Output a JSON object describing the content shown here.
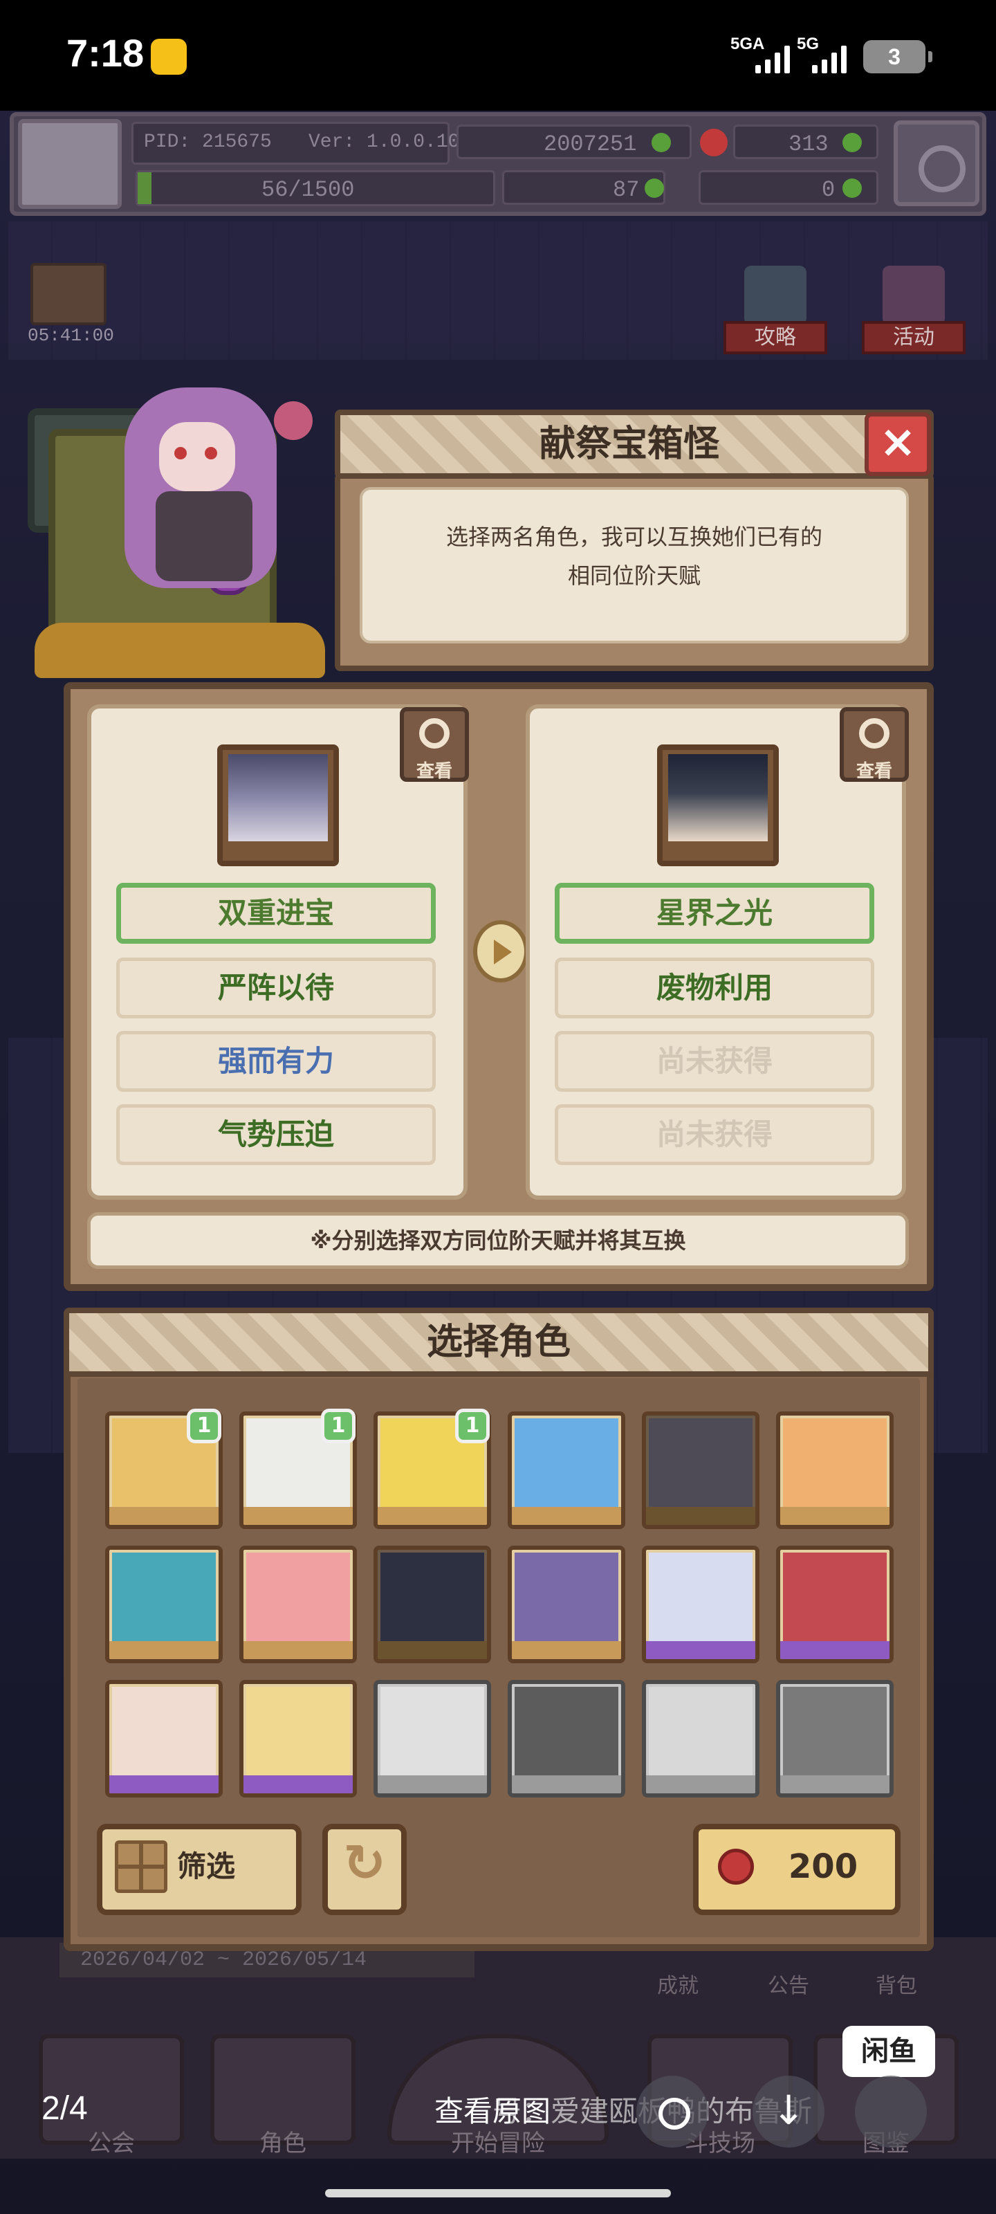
{
  "status_bar": {
    "time": "7:18",
    "signal1": "5GA",
    "signal2": "5G",
    "battery": "3"
  },
  "hud": {
    "pid": "PID: 215675",
    "version": "Ver: 1.0.0.10",
    "gold": "2007251",
    "red_gems": "313",
    "exp": "56/1500",
    "clover": "87",
    "key": "0",
    "colors": {
      "green_gem": "#5aa03a",
      "red_gem": "#c23a3a"
    }
  },
  "side": {
    "chest_timer": "05:41:00",
    "guide_label": "攻略",
    "event_label": "活动"
  },
  "modal": {
    "title": "献祭宝箱怪",
    "close_icon": "×",
    "description_line1": "选择两名角色，我可以互换她们已有的",
    "description_line2": "相同位阶天赋"
  },
  "swap": {
    "left": {
      "view_label": "查看",
      "talents": [
        {
          "label": "双重进宝",
          "state": "selected"
        },
        {
          "label": "严阵以待",
          "state": "owned"
        },
        {
          "label": "强而有力",
          "state": "owned"
        },
        {
          "label": "气势压迫",
          "state": "owned"
        }
      ]
    },
    "right": {
      "view_label": "查看",
      "talents": [
        {
          "label": "星界之光",
          "state": "selected"
        },
        {
          "label": "废物利用",
          "state": "owned"
        },
        {
          "label": "尚未获得",
          "state": "locked"
        },
        {
          "label": "尚未获得",
          "state": "locked"
        }
      ]
    },
    "hint": "※分别选择双方同位阶天赋并将其互换"
  },
  "select": {
    "title": "选择角色",
    "badge": "1",
    "filter_label": "筛选",
    "cost": "200"
  },
  "background": {
    "date_range": "2026/04/02 ~ 2026/05/14",
    "mini_labels": [
      "成就",
      "公告",
      "背包"
    ],
    "nav_labels": [
      "公会",
      "角色",
      "开始冒险",
      "斗技场",
      "图鉴"
    ]
  },
  "viewer": {
    "counter": "2/4",
    "view_original": "查看原图",
    "watermark": "号：爱建瓯板鸭的布鲁斯",
    "logo": "闲鱼"
  }
}
